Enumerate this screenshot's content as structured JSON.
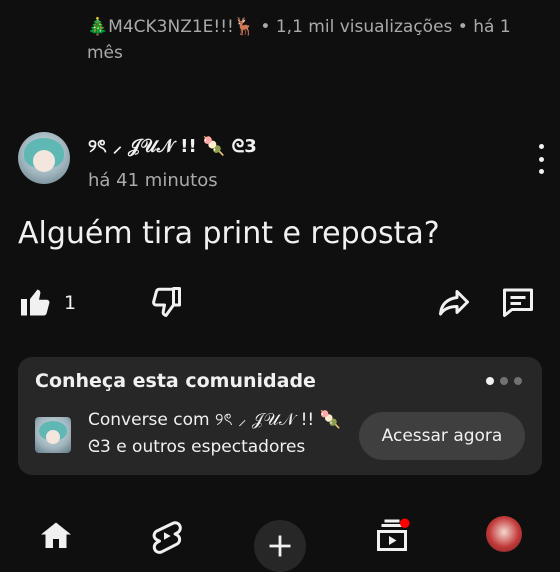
{
  "previous_post": {
    "channel": "🎄M4CK3NZ1E!!!🦌",
    "meta": " • 1,1 mil visualizações • há 1 mês"
  },
  "post": {
    "author": "୨ৎ ⸝ 𝒥𝒰𝒩 !! 🍡 ᘓ3",
    "time": "há 41 minutos",
    "text": "Alguém tira print e reposta?",
    "like_count": "1"
  },
  "community_card": {
    "title": "Conheça esta comunidade",
    "description": "Converse com ୨ৎ ⸝ 𝒥𝒰𝒩 !! 🍡 ᘓ3 e outros espectadores",
    "button_label": "Acessar agora"
  },
  "colors": {
    "background": "#0f0f0f",
    "card": "#272727",
    "secondary_text": "#aaaaaa",
    "notification": "#ff0000"
  },
  "icons": {
    "like": "thumbs-up-icon",
    "dislike": "thumbs-down-icon",
    "share": "share-icon",
    "comment": "comment-icon",
    "more": "kebab-menu-icon",
    "home": "home-icon",
    "shorts": "shorts-icon",
    "create": "plus-icon",
    "subscriptions": "subscriptions-icon"
  }
}
